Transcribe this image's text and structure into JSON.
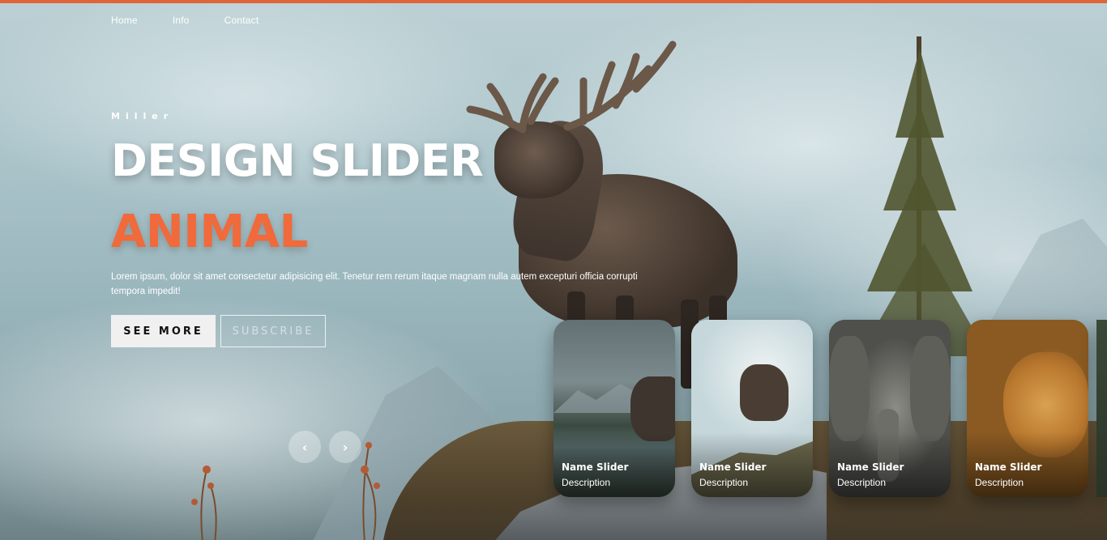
{
  "colors": {
    "accent": "#f06a3c",
    "top_bar": "#e0643a",
    "primary_button_bg": "#f0f0f0"
  },
  "nav": {
    "items": [
      "Home",
      "Info",
      "Contact"
    ]
  },
  "hero": {
    "author": "Miller",
    "title": "DESIGN SLIDER",
    "topic": "ANIMAL",
    "description": "Lorem ipsum, dolor sit amet consectetur adipisicing elit. Tenetur rem rerum itaque magnam nulla autem excepturi officia corrupti tempora impedit!",
    "buttons": {
      "see_more": "SEE MORE",
      "subscribe": "SUBSCRIBE"
    }
  },
  "arrows": {
    "prev_icon": "chevron-left-icon",
    "next_icon": "chevron-right-icon",
    "prev": "‹",
    "next": "›"
  },
  "thumbnails": [
    {
      "name": "Name Slider",
      "description": "Description",
      "image": "moose-lake"
    },
    {
      "name": "Name Slider",
      "description": "Description",
      "image": "moose-hill"
    },
    {
      "name": "Name Slider",
      "description": "Description",
      "image": "elephant"
    },
    {
      "name": "Name Slider",
      "description": "Description",
      "image": "leopard"
    }
  ]
}
